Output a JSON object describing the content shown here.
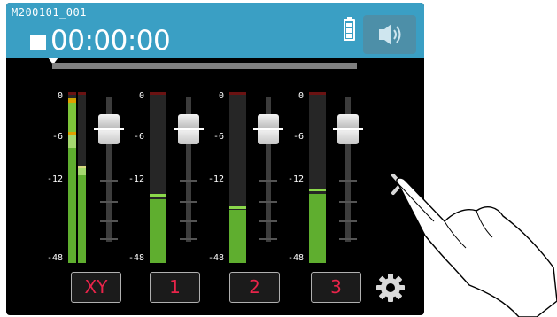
{
  "header": {
    "filename": "M200101_001",
    "timecode": "00:00:00",
    "state_icon": "stop-icon",
    "battery_icon": "battery-full-icon",
    "speaker_icon": "speaker-icon",
    "progress": 0
  },
  "channels": [
    {
      "label": "XY",
      "ticks": [
        "0",
        "-6",
        "-12",
        "-48"
      ]
    },
    {
      "label": "1",
      "ticks": [
        "0",
        "-6",
        "-12",
        "-48"
      ]
    },
    {
      "label": "2",
      "ticks": [
        "0",
        "-6",
        "-12",
        "-48"
      ]
    },
    {
      "label": "3",
      "ticks": [
        "0",
        "-6",
        "-12",
        "-48"
      ]
    }
  ],
  "footer": {
    "settings_icon": "gear-icon"
  },
  "nav": {
    "next_icon": "chevron-right-icon"
  },
  "colors": {
    "topbar": "#3a9fc4",
    "meter_green": "#5fae2f",
    "label_red": "#e8244a",
    "background": "#000000"
  }
}
